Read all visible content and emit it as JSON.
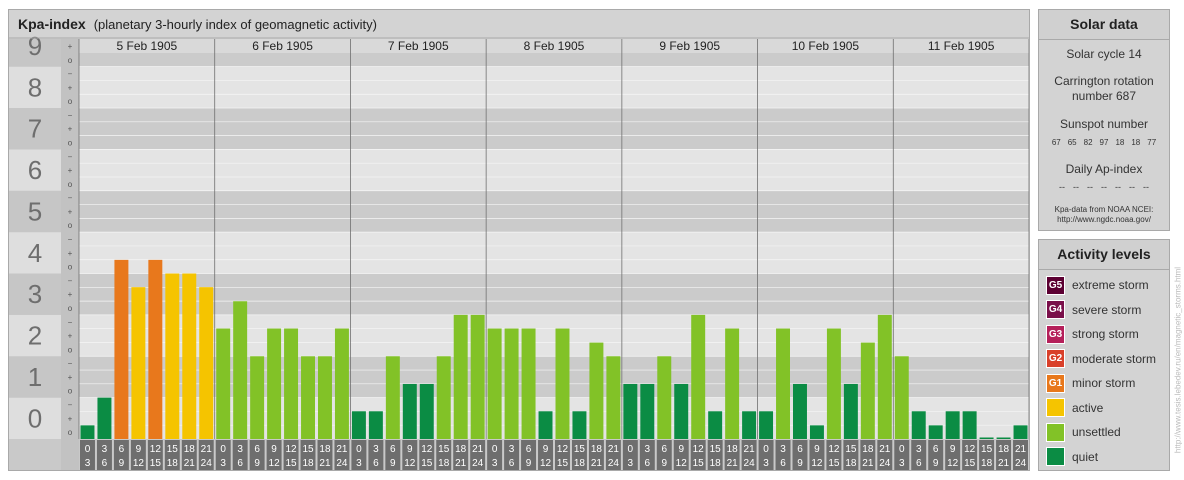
{
  "title": {
    "main": "Kpa-index",
    "subtitle": "(planetary 3-hourly index of geomagnetic activity)"
  },
  "solar": {
    "heading": "Solar data",
    "cycle": "Solar cycle 14",
    "carrington_line1": "Carrington rotation",
    "carrington_line2": "number 687",
    "sunspot_label": "Sunspot number",
    "sunspot_values": [
      "67",
      "65",
      "82",
      "97",
      "18",
      "18",
      "77"
    ],
    "ap_label": "Daily Ap-index",
    "ap_values": [
      "--",
      "--",
      "--",
      "--",
      "--",
      "--",
      "--"
    ],
    "source_line1": "Kpa-data from NOAA NCEI:",
    "source_line2": "http://www.ngdc.noaa.gov/"
  },
  "levels": {
    "heading": "Activity levels",
    "items": [
      {
        "code": "G5",
        "label": "extreme storm",
        "color": "#5c0032"
      },
      {
        "code": "G4",
        "label": "severe storm",
        "color": "#7a0f4a"
      },
      {
        "code": "G3",
        "label": "strong storm",
        "color": "#b5205a"
      },
      {
        "code": "G2",
        "label": "moderate storm",
        "color": "#d9402a"
      },
      {
        "code": "G1",
        "label": "minor storm",
        "color": "#e8781c"
      },
      {
        "code": "",
        "label": "active",
        "color": "#f5c400"
      },
      {
        "code": "",
        "label": "unsettled",
        "color": "#82c227"
      },
      {
        "code": "",
        "label": "quiet",
        "color": "#0b8c44"
      }
    ]
  },
  "credit": "http://www.tesis.lebedev.ru/en/magnetic_storms.html",
  "chart_data": {
    "type": "bar",
    "title": "Kpa-index",
    "ylim": [
      0,
      9.33
    ],
    "y_ticks": [
      "0",
      "1",
      "2",
      "3",
      "4",
      "5",
      "6",
      "7",
      "8",
      "9"
    ],
    "minor_labels": [
      "o",
      "+",
      "−"
    ],
    "days": [
      "5 Feb 1905",
      "6 Feb 1905",
      "7 Feb 1905",
      "8 Feb 1905",
      "9 Feb 1905",
      "10 Feb 1905",
      "11 Feb 1905"
    ],
    "hour_top": [
      "0",
      "3",
      "6",
      "9",
      "12",
      "15",
      "18",
      "21"
    ],
    "hour_bottom": [
      "3",
      "6",
      "9",
      "12",
      "15",
      "18",
      "21",
      "24"
    ],
    "values": [
      0.33,
      1.0,
      4.33,
      3.67,
      4.33,
      4.0,
      4.0,
      3.67,
      2.67,
      3.33,
      2.0,
      2.67,
      2.67,
      2.0,
      2.0,
      2.67,
      0.67,
      0.67,
      2.0,
      1.33,
      1.33,
      2.0,
      3.0,
      3.0,
      2.67,
      2.67,
      2.67,
      0.67,
      2.67,
      0.67,
      2.33,
      2.0,
      1.33,
      1.33,
      2.0,
      1.33,
      3.0,
      0.67,
      2.67,
      0.67,
      0.67,
      2.67,
      1.33,
      0.33,
      2.67,
      1.33,
      2.33,
      3.0,
      2.0,
      0.67,
      0.33,
      0.67,
      0.67,
      0.0,
      0.0,
      0.33
    ],
    "colors": {
      "quiet": "#0b8c44",
      "unsettled": "#82c227",
      "active": "#f5c400",
      "minor": "#e8781c",
      "moderate": "#d9402a"
    }
  }
}
